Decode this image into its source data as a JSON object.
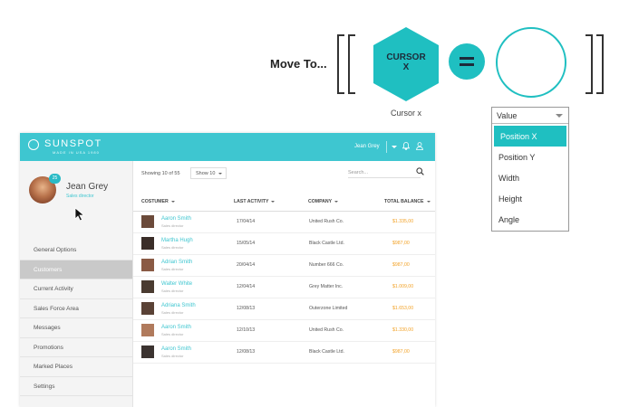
{
  "formula": {
    "move_label": "Move To...",
    "hex_line1": "CURSOR",
    "hex_line2": "X",
    "hex_caption": "Cursor x",
    "colors": {
      "accent": "#1fbfc1",
      "dark": "#1d2b3a"
    }
  },
  "dropdown": {
    "selected": "Value",
    "options": [
      "Position X",
      "Position Y",
      "Width",
      "Height",
      "Angle"
    ],
    "highlighted": "Position X"
  },
  "app": {
    "logo": "SUNSPOT",
    "logo_sub": "MADE IN USA 1980",
    "topbar_user": "Jean Grey",
    "user": {
      "name": "Jean Grey",
      "role": "Sales director",
      "badge": "25"
    },
    "nav": [
      "General Options",
      "Customers",
      "Current Activity",
      "Sales Force Area",
      "Messages",
      "Promotions",
      "Marked Places",
      "Settings"
    ],
    "active_nav": "Customers",
    "toolbar": {
      "showing": "Showing 10 of 55",
      "show_select": "Show 10",
      "search_placeholder": "Search..."
    },
    "table": {
      "headers": [
        "COSTUMER",
        "LAST ACTIVITY",
        "COMPANY",
        "TOTAL BALANCE"
      ],
      "rows": [
        {
          "name": "Aaron Smith",
          "role": "Sales director",
          "date": "17/04/14",
          "company": "United Rush Co.",
          "balance": "$1.335,00"
        },
        {
          "name": "Martha Hugh",
          "role": "Sales director",
          "date": "15/05/14",
          "company": "Black Castle Ltd.",
          "balance": "$987,00"
        },
        {
          "name": "Adrian Smith",
          "role": "Sales director",
          "date": "20/04/14",
          "company": "Number 666 Co.",
          "balance": "$987,00"
        },
        {
          "name": "Walter White",
          "role": "Sales director",
          "date": "12/04/14",
          "company": "Grey Matter Inc.",
          "balance": "$1.009,00"
        },
        {
          "name": "Adriana Smith",
          "role": "Sales director",
          "date": "12/08/13",
          "company": "Outerzone Limited",
          "balance": "$1.653,00"
        },
        {
          "name": "Aaron Smith",
          "role": "Sales director",
          "date": "12/10/13",
          "company": "United Rush Co.",
          "balance": "$1.330,00"
        },
        {
          "name": "Aaron Smith",
          "role": "Sales director",
          "date": "12/08/13",
          "company": "Black Castle Ltd.",
          "balance": "$987,00"
        }
      ]
    },
    "colors": {
      "topbar": "#3ec6d0",
      "balance": "#f2a227",
      "link": "#3ec6d0"
    }
  }
}
